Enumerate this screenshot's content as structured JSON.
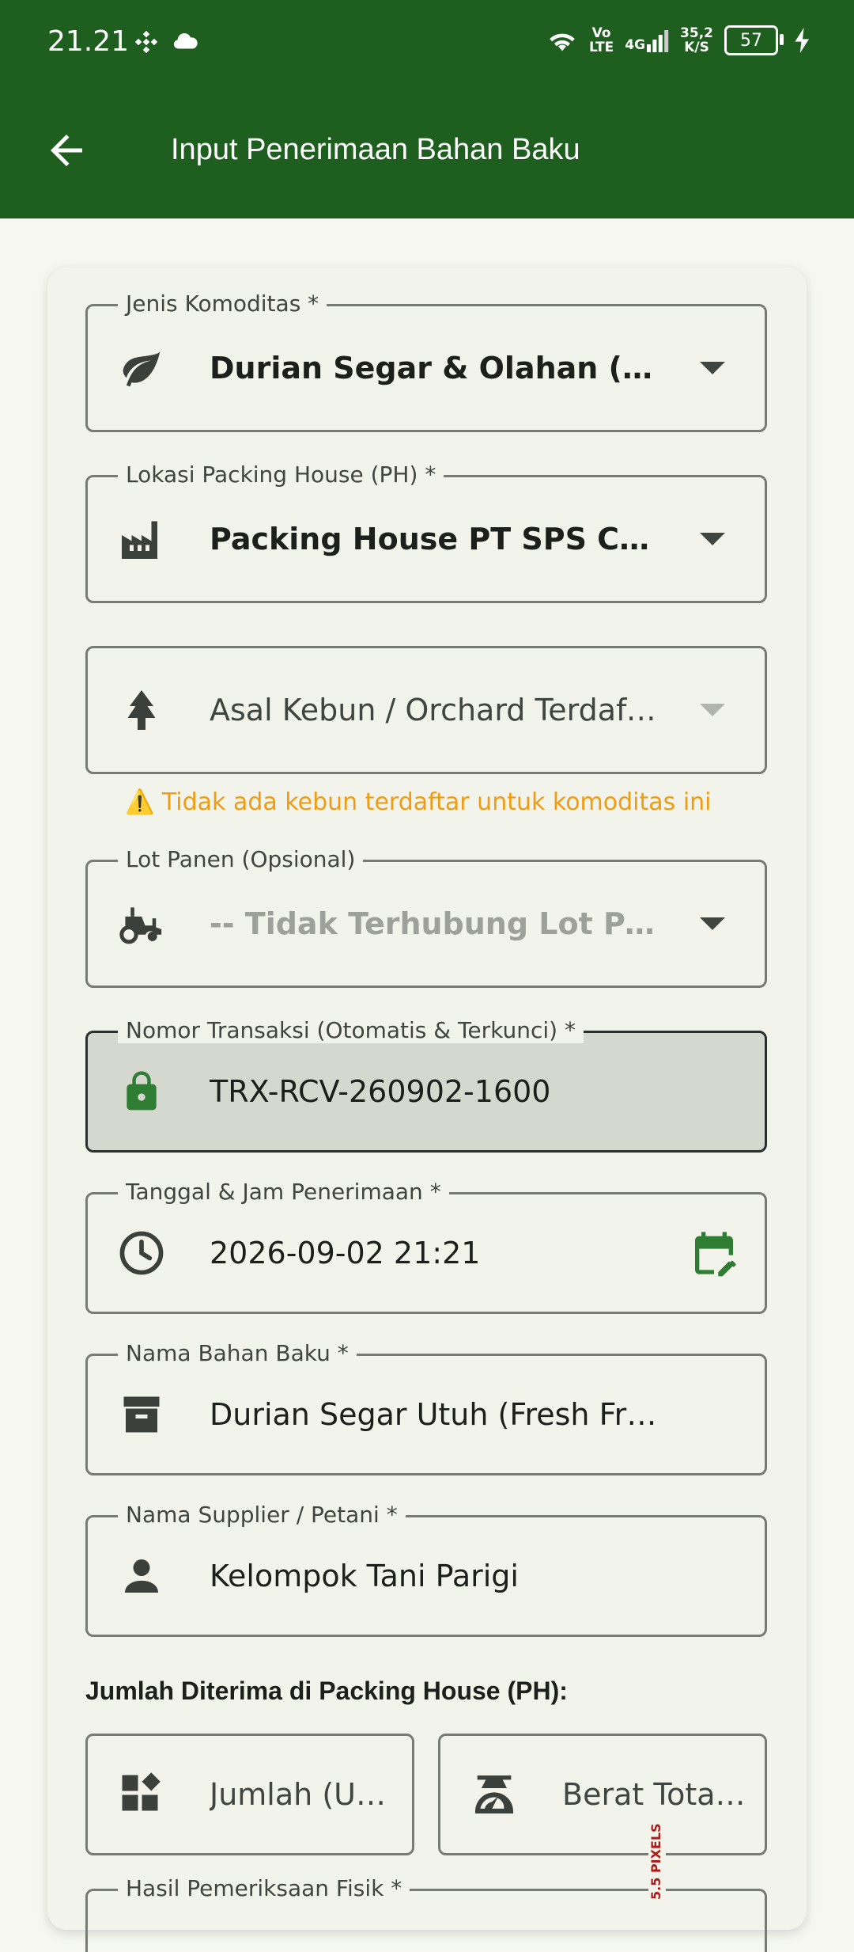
{
  "status_bar": {
    "time": "21.21",
    "volte_top": "Vo",
    "volte_bottom": "LTE",
    "network": "4G",
    "speed_top": "35,2",
    "speed_bottom": "K/S",
    "battery": "57"
  },
  "app_bar": {
    "title": "Input Penerimaan Bahan Baku",
    "back_icon": "arrow-left-icon"
  },
  "form": {
    "komoditas": {
      "label": "Jenis Komoditas *",
      "value": "Durian Segar & Olahan (DURIAN)",
      "icon": "leaf-icon"
    },
    "lokasi": {
      "label": "Lokasi Packing House (PH) *",
      "value": "Packing House PT SPS Central",
      "icon": "factory-icon"
    },
    "kebun": {
      "value": "Asal Kebun / Orchard Terdaftar",
      "icon": "tree-icon"
    },
    "warning": "⚠️ Tidak ada kebun terdaftar untuk komoditas ini",
    "lot": {
      "label": "Lot Panen (Opsional)",
      "value": "-- Tidak Terhubung Lot Panen",
      "icon": "tractor-icon"
    },
    "nomor": {
      "label": "Nomor Transaksi (Otomatis & Terkunci) *",
      "value": "TRX-RCV-260902-1600",
      "icon": "lock-icon"
    },
    "tanggal": {
      "label": "Tanggal & Jam Penerimaan *",
      "value": "2026-09-02 21:21",
      "icon": "clock-icon",
      "action_icon": "calendar-edit-icon"
    },
    "bahan": {
      "label": "Nama Bahan Baku *",
      "value": "Durian Segar Utuh (Fresh Fruit)",
      "icon": "archive-icon"
    },
    "supplier": {
      "label": "Nama Supplier / Petani *",
      "value": "Kelompok Tani Parigi",
      "icon": "person-icon"
    },
    "jumlah_section": "Jumlah Diterima di Packing House (PH):",
    "jumlah": {
      "value": "Jumlah (Unit)",
      "icon": "widgets-icon"
    },
    "berat": {
      "value": "Berat Total (Kg)",
      "icon": "scale-icon"
    },
    "pemeriksaan": {
      "label": "Hasil Pemeriksaan Fisik *"
    }
  },
  "debug_overlay": "5.5 PIXELS",
  "colors": {
    "primary": "#1e5e1e",
    "accent_green": "#2e7d32",
    "warning": "#ef9c12",
    "background": "#f6f7f1"
  }
}
